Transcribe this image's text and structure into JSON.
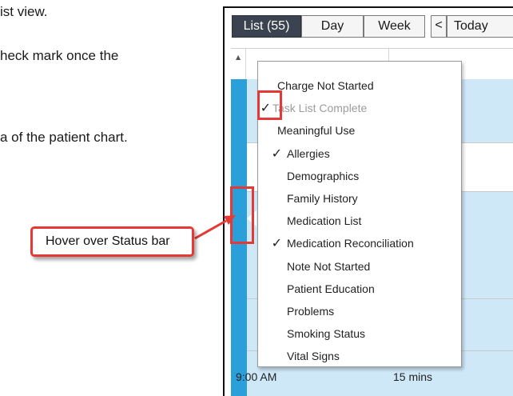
{
  "document": {
    "line1": "ist view.",
    "line2": "heck mark once the",
    "line3": "a of the patient chart."
  },
  "toolbar": {
    "list_label": "List  (55)",
    "day_label": "Day",
    "week_label": "Week",
    "prev_glyph": "<",
    "today_label": "Today"
  },
  "grid": {
    "sort_glyph": "▲",
    "row_time": "9:00 AM",
    "row_duration": "15 mins"
  },
  "status_menu": {
    "items": [
      {
        "label": "Charge Not Started",
        "checked": false,
        "muted": false
      },
      {
        "label": "Task List Complete",
        "checked": true,
        "muted": true
      },
      {
        "label": "Meaningful Use",
        "checked": false,
        "muted": false
      },
      {
        "label": "Allergies",
        "checked": true,
        "muted": false
      },
      {
        "label": "Demographics",
        "checked": false,
        "muted": false
      },
      {
        "label": "Family History",
        "checked": false,
        "muted": false
      },
      {
        "label": "Medication List",
        "checked": false,
        "muted": false
      },
      {
        "label": "Medication Reconciliation",
        "checked": true,
        "muted": false
      },
      {
        "label": "Note Not Started",
        "checked": false,
        "muted": false
      },
      {
        "label": "Patient Education",
        "checked": false,
        "muted": false
      },
      {
        "label": "Problems",
        "checked": false,
        "muted": false
      },
      {
        "label": "Smoking Status",
        "checked": false,
        "muted": false
      },
      {
        "label": "Vital Signs",
        "checked": false,
        "muted": false
      }
    ],
    "check_glyph": "✓"
  },
  "callout": {
    "text": "Hover over Status bar"
  },
  "colors": {
    "highlight": "#e53935",
    "status_bar": "#2b9fda",
    "row_blue": "#cfe8f8",
    "list_tab_active": "#3b4350"
  },
  "icons": [
    "chevron-left-icon",
    "check-icon",
    "sort-up-icon",
    "status-handle-icon",
    "arrow-icon"
  ]
}
